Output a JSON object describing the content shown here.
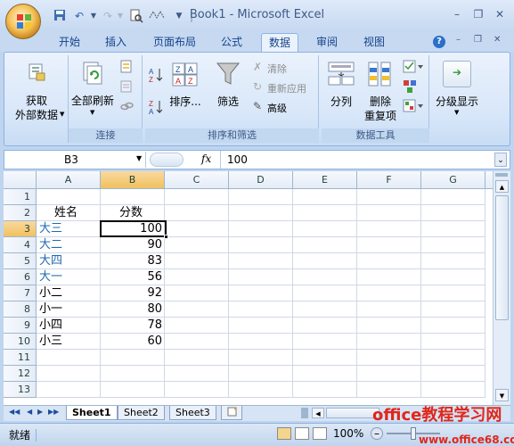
{
  "window": {
    "title": "Book1 - Microsoft Excel",
    "minimize": "–",
    "restore": "❐",
    "close": "✕"
  },
  "ribbon_tabs": [
    {
      "label": "开始"
    },
    {
      "label": "插入"
    },
    {
      "label": "页面布局"
    },
    {
      "label": "公式"
    },
    {
      "label": "数据",
      "active": true
    },
    {
      "label": "审阅"
    },
    {
      "label": "视图"
    }
  ],
  "ribbon": {
    "get_external": {
      "line1": "获取",
      "line2": "外部数据"
    },
    "connections": {
      "refresh_all": "全部刷新",
      "group": "连接"
    },
    "sort_filter": {
      "sort": "排序...",
      "filter": "筛选",
      "clear": "清除",
      "reapply": "重新应用",
      "advanced": "高级",
      "group": "排序和筛选"
    },
    "data_tools": {
      "text_to_columns": "分列",
      "remove_dup_line1": "删除",
      "remove_dup_line2": "重复项",
      "group": "数据工具"
    },
    "outline": {
      "label": "分级显示"
    }
  },
  "formula_bar": {
    "name_box": "B3",
    "fx": "fx",
    "value": "100"
  },
  "grid": {
    "columns": [
      "A",
      "B",
      "C",
      "D",
      "E",
      "F",
      "G"
    ],
    "selected_cell": "B3",
    "rows": [
      {
        "num": "1",
        "a": "",
        "b": ""
      },
      {
        "num": "2",
        "a": "姓名",
        "b": "分数"
      },
      {
        "num": "3",
        "a": "大三",
        "b": "100"
      },
      {
        "num": "4",
        "a": "大二",
        "b": "90"
      },
      {
        "num": "5",
        "a": "大四",
        "b": "83"
      },
      {
        "num": "6",
        "a": "大一",
        "b": "56"
      },
      {
        "num": "7",
        "a": "小二",
        "b": "92"
      },
      {
        "num": "8",
        "a": "小一",
        "b": "80"
      },
      {
        "num": "9",
        "a": "小四",
        "b": "78"
      },
      {
        "num": "10",
        "a": "小三",
        "b": "60"
      },
      {
        "num": "11",
        "a": "",
        "b": ""
      },
      {
        "num": "12",
        "a": "",
        "b": ""
      },
      {
        "num": "13",
        "a": "",
        "b": ""
      }
    ]
  },
  "sheets": [
    {
      "name": "Sheet1",
      "active": true
    },
    {
      "name": "Sheet2"
    },
    {
      "name": "Sheet3"
    }
  ],
  "status": {
    "ready": "就绪",
    "zoom": "100%"
  },
  "watermark": {
    "line1": "office教程学习网",
    "line2": "www.office68.com"
  },
  "colors": {
    "accent": "#15428b",
    "selected_header": "#f1c15f",
    "blue_text": "#1f6ab0"
  }
}
